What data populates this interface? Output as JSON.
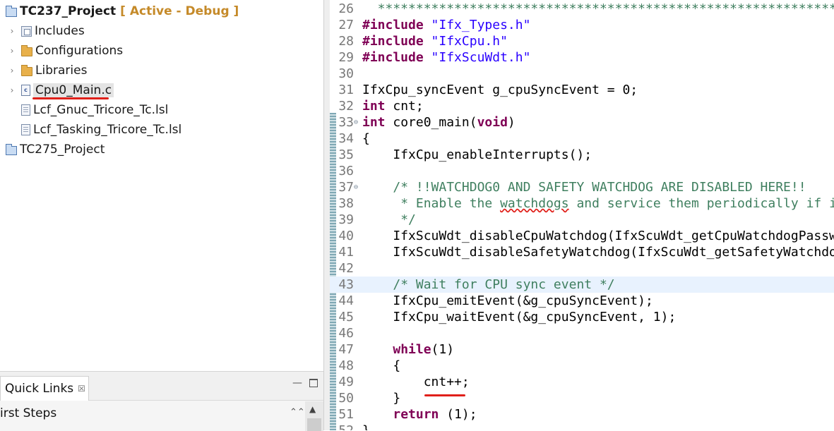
{
  "project_explorer": {
    "root": {
      "name": "TC237_Project",
      "status": "[ Active - Debug ]"
    },
    "items": [
      {
        "label": "Includes",
        "icon": "includes-icon"
      },
      {
        "label": "Configurations",
        "icon": "folder-icon"
      },
      {
        "label": "Libraries",
        "icon": "folder-icon"
      },
      {
        "label": "Cpu0_Main.c",
        "icon": "c-file-icon"
      },
      {
        "label": "Lcf_Gnuc_Tricore_Tc.lsl",
        "icon": "file-icon"
      },
      {
        "label": "Lcf_Tasking_Tricore_Tc.lsl",
        "icon": "file-icon"
      }
    ],
    "second_project": "TC275_Project"
  },
  "quick_links": {
    "tab_label": "Quick Links",
    "close_glyph": "☒",
    "section": "irst Steps",
    "collapse_glyph": "»",
    "minimize_glyph": "▭",
    "scroll_up_glyph": "▲"
  },
  "editor": {
    "lines": [
      {
        "n": "26",
        "segs": [
          [
            "com",
            "  ********************************************************************************"
          ]
        ]
      },
      {
        "n": "27",
        "segs": [
          [
            "kw",
            "#include"
          ],
          [
            "",
            " "
          ],
          [
            "str",
            "\"Ifx_Types.h\""
          ]
        ]
      },
      {
        "n": "28",
        "segs": [
          [
            "kw",
            "#include"
          ],
          [
            "",
            " "
          ],
          [
            "str",
            "\"IfxCpu.h\""
          ]
        ]
      },
      {
        "n": "29",
        "segs": [
          [
            "kw",
            "#include"
          ],
          [
            "",
            " "
          ],
          [
            "str",
            "\"IfxScuWdt.h\""
          ]
        ]
      },
      {
        "n": "30",
        "segs": []
      },
      {
        "n": "31",
        "segs": [
          [
            "",
            "IfxCpu_syncEvent g_cpuSyncEvent = 0;"
          ]
        ]
      },
      {
        "n": "32",
        "segs": [
          [
            "kw",
            "int"
          ],
          [
            "",
            " cnt;"
          ]
        ]
      },
      {
        "n": "33",
        "fold": "⊖",
        "segs": [
          [
            "kw",
            "int"
          ],
          [
            "",
            " core0_main("
          ],
          [
            "kw",
            "void"
          ],
          [
            "",
            ")"
          ]
        ]
      },
      {
        "n": "34",
        "segs": [
          [
            "",
            "{"
          ]
        ]
      },
      {
        "n": "35",
        "segs": [
          [
            "",
            "    IfxCpu_enableInterrupts();"
          ]
        ]
      },
      {
        "n": "36",
        "segs": []
      },
      {
        "n": "37",
        "fold": "⊖",
        "segs": [
          [
            "",
            "    "
          ],
          [
            "com",
            "/* !!WATCHDOG0 AND SAFETY WATCHDOG ARE DISABLED HERE!!"
          ]
        ]
      },
      {
        "n": "38",
        "segs": [
          [
            "",
            "     "
          ],
          [
            "com",
            "* Enable the "
          ],
          [
            "com sp-line",
            "watchdogs"
          ],
          [
            "com",
            " and service them periodically if it is required"
          ]
        ]
      },
      {
        "n": "39",
        "segs": [
          [
            "",
            "     "
          ],
          [
            "com",
            "*/"
          ]
        ]
      },
      {
        "n": "40",
        "segs": [
          [
            "",
            "    IfxScuWdt_disableCpuWatchdog(IfxScuWdt_getCpuWatchdogPassword());"
          ]
        ]
      },
      {
        "n": "41",
        "segs": [
          [
            "",
            "    IfxScuWdt_disableSafetyWatchdog(IfxScuWdt_getSafetyWatchdogPassword());"
          ]
        ]
      },
      {
        "n": "42",
        "segs": []
      },
      {
        "n": "43",
        "hl": true,
        "segs": [
          [
            "",
            "    "
          ],
          [
            "com",
            "/* Wait for CPU sync event */"
          ]
        ]
      },
      {
        "n": "44",
        "segs": [
          [
            "",
            "    IfxCpu_emitEvent(&g_cpuSyncEvent);"
          ]
        ]
      },
      {
        "n": "45",
        "segs": [
          [
            "",
            "    IfxCpu_waitEvent(&g_cpuSyncEvent, 1);"
          ]
        ]
      },
      {
        "n": "46",
        "segs": []
      },
      {
        "n": "47",
        "segs": [
          [
            "",
            "    "
          ],
          [
            "kw",
            "while"
          ],
          [
            "",
            "(1)"
          ]
        ]
      },
      {
        "n": "48",
        "segs": [
          [
            "",
            "    {"
          ]
        ]
      },
      {
        "n": "49",
        "segs": [
          [
            "",
            "        cnt++;"
          ]
        ]
      },
      {
        "n": "50",
        "segs": [
          [
            "",
            "    }"
          ]
        ]
      },
      {
        "n": "51",
        "segs": [
          [
            "",
            "    "
          ],
          [
            "kw",
            "return"
          ],
          [
            "",
            " (1);"
          ]
        ]
      },
      {
        "n": "52",
        "segs": [
          [
            "",
            "}"
          ]
        ]
      }
    ]
  },
  "colors": {
    "keyword": "#7f0055",
    "string": "#2a00ff",
    "comment": "#3f7f5f",
    "annotation_red": "#e0201a",
    "active_status": "#c58a29",
    "current_line": "#e8f2fe"
  }
}
